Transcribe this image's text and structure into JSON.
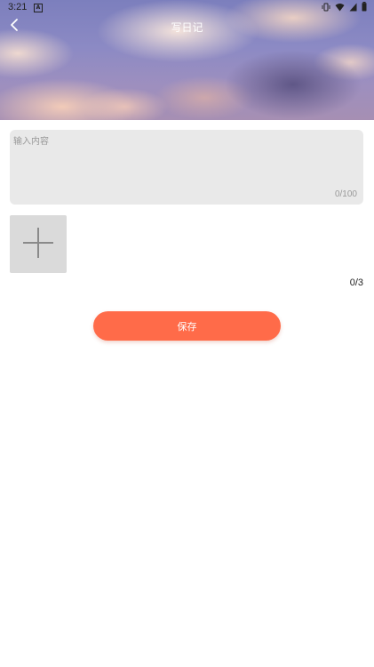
{
  "status_bar": {
    "time": "3:21",
    "app_indicator": "A"
  },
  "nav": {
    "title": "写日记",
    "back_icon": "chevron-left-icon"
  },
  "content": {
    "placeholder": "输入内容",
    "value": "",
    "char_count": "0/100"
  },
  "photos": {
    "add_icon": "plus-icon",
    "count": "0/3"
  },
  "actions": {
    "save_label": "保存"
  },
  "colors": {
    "accent": "#ff6b49",
    "input_bg": "#e9e9e9",
    "placeholder": "#999999",
    "photo_bg": "#dadada"
  }
}
